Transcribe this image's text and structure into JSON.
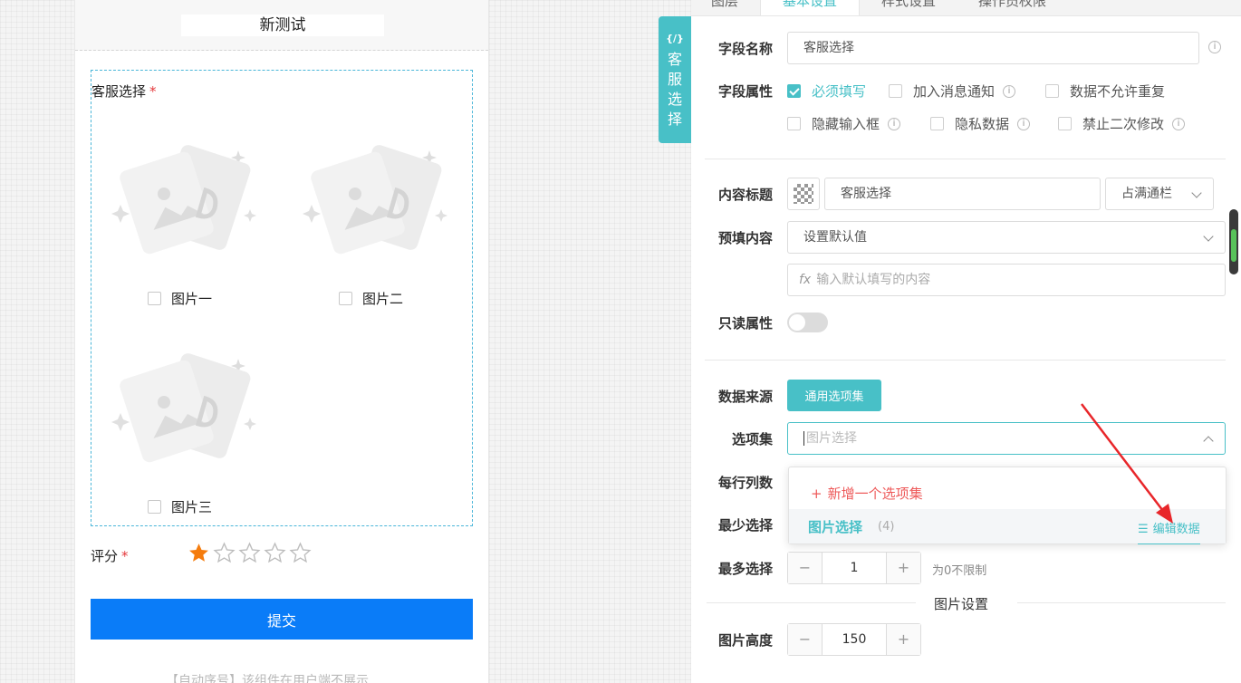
{
  "preview": {
    "title": "新测试",
    "field_label": "客服选择",
    "required_mark": "*",
    "images": [
      {
        "label": "图片一"
      },
      {
        "label": "图片二"
      },
      {
        "label": "图片三"
      }
    ],
    "rating_label": "评分",
    "rating_value": 1,
    "rating_max": 5,
    "submit_label": "提交",
    "hint": "【自动序号】该组件在用户端不展示"
  },
  "side_tab": {
    "code": "{/}",
    "label": "客服选择"
  },
  "tabs": [
    "图层",
    "基本设置",
    "样式设置",
    "操作员权限"
  ],
  "settings": {
    "field_name_label": "字段名称",
    "field_name_value": "客服选择",
    "field_attr_label": "字段属性",
    "attrs": [
      {
        "label": "必须填写",
        "checked": true
      },
      {
        "label": "加入消息通知",
        "checked": false
      },
      {
        "label": "数据不允许重复",
        "checked": false
      },
      {
        "label": "隐藏输入框",
        "checked": false
      },
      {
        "label": "隐私数据",
        "checked": false
      },
      {
        "label": "禁止二次修改",
        "checked": false
      }
    ],
    "content_title_label": "内容标题",
    "content_title_value": "客服选择",
    "content_title_width": "占满通栏",
    "prefill_label": "预填内容",
    "prefill_select": "设置默认值",
    "prefill_placeholder": "输入默认填写的内容",
    "fx_label": "fx",
    "readonly_label": "只读属性",
    "readonly_on": false,
    "datasource_label": "数据来源",
    "datasource_button": "通用选项集",
    "optionset_label": "选项集",
    "optionset_value": "图片选择",
    "per_row_label": "每行列数",
    "min_select_label": "最少选择",
    "max_select_label": "最多选择",
    "max_select_value": "1",
    "max_select_hint": "为0不限制",
    "image_section_title": "图片设置",
    "image_height_label": "图片高度",
    "image_height_value": "150",
    "dropdown": {
      "add_label": "新增一个选项集",
      "item_name": "图片选择",
      "item_count": "(4)",
      "edit_label": "编辑数据"
    }
  },
  "colors": {
    "accent": "#48c0c7",
    "submit": "#0a7cf8",
    "star": "#f57c0d",
    "required": "#e4393c",
    "arrow": "#e8262a"
  }
}
